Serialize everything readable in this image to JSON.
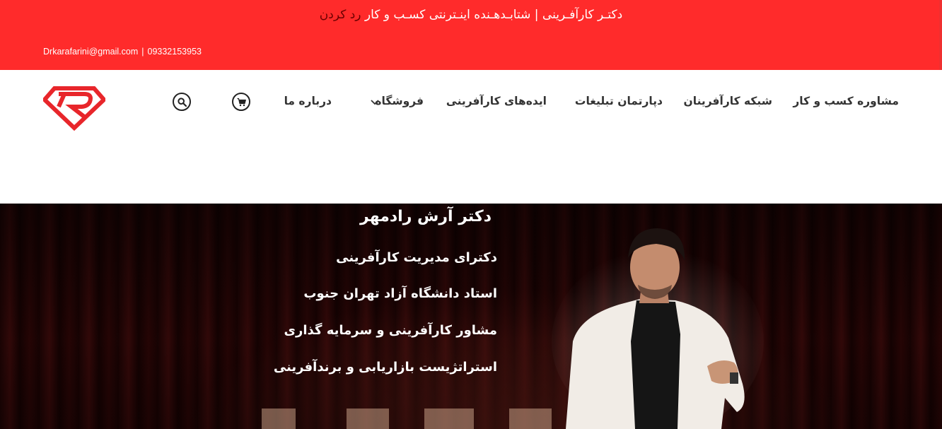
{
  "topbar": {
    "tagline_main": "دکتـر کارآفـرینی | شتابـدهـنده اینـترنتی کسـب و کار",
    "tagline_accent": "رد کردن",
    "email": "Drkarafarini@gmail.com",
    "separator": "|",
    "phone": "09332153953"
  },
  "header": {
    "nav": [
      {
        "label": "مشاوره کسب و کار"
      },
      {
        "label": "شبکه کارآفرینان"
      },
      {
        "label": "دپارتمان تبلیغات"
      },
      {
        "label": "ایده‌های کارآفرینی"
      },
      {
        "label": "فروشگاه"
      },
      {
        "label": "درباره ما"
      }
    ],
    "icons": {
      "cart": "cart-icon",
      "search": "search-icon",
      "dropdown": "chevron-down-icon",
      "logo": "logo-icon"
    }
  },
  "hero": {
    "title": "دکتر آرش رادمهر",
    "lines": [
      "دکترای مدیریت کارآفرینی",
      "استاد دانشگاه آزاد تهران جنوب",
      "مشاور کارآفرینی و سرمایه گذاری",
      "استراتژیست بازاریابی و برندآفرینی"
    ]
  },
  "colors": {
    "brand_red": "#ff2b2b",
    "accent_dark_red": "#6b0000",
    "logo_red": "#e8262b",
    "curtain": "#2a0606"
  }
}
